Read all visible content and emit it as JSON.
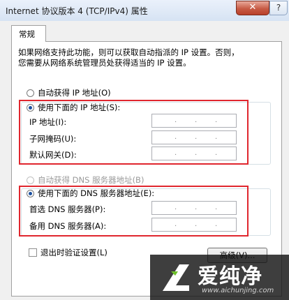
{
  "window": {
    "title": "Internet 协议版本 4 (TCP/IPv4) 属性",
    "close_label": "✕",
    "help_label": "?"
  },
  "tabs": [
    {
      "label": "常规"
    }
  ],
  "description": {
    "line1": "如果网络支持此功能，则可以获取自动指派的 IP 设置。否则，",
    "line2": "您需要从网络系统管理员处获得适当的 IP 设置。"
  },
  "ip_section": {
    "auto_label": "自动获得 IP 地址(O)",
    "manual_label": "使用下面的 IP 地址(S):",
    "fields": [
      {
        "label": "IP 地址(I):",
        "value": ". . ."
      },
      {
        "label": "子网掩码(U):",
        "value": ". . ."
      },
      {
        "label": "默认网关(D):",
        "value": ". . ."
      }
    ]
  },
  "dns_section": {
    "auto_label": "自动获得 DNS 服务器地址(B)",
    "manual_label": "使用下面的 DNS 服务器地址(E):",
    "fields": [
      {
        "label": "首选 DNS 服务器(P):",
        "value": ". . ."
      },
      {
        "label": "备用 DNS 服务器(A):",
        "value": ". . ."
      }
    ]
  },
  "validate_label": "退出时验证设置(L)",
  "advanced_label": "高级(V)...",
  "watermark": {
    "brand": "爱纯净",
    "url": "www.aichunjing.com"
  },
  "colors": {
    "highlight_frame": "#e0262e",
    "radio_selected": "#1a4fa0"
  }
}
